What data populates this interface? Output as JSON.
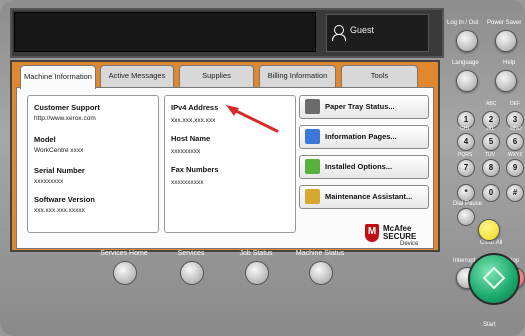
{
  "header": {
    "user": "Guest"
  },
  "tabs": [
    {
      "label": "Machine Information",
      "active": true
    },
    {
      "label": "Active Messages",
      "active": false
    },
    {
      "label": "Supplies",
      "active": false
    },
    {
      "label": "Billing Information",
      "active": false
    },
    {
      "label": "Tools",
      "active": false
    }
  ],
  "left_info": {
    "customer_support_label": "Customer Support",
    "customer_support_value": "http://www.xerox.com",
    "model_label": "Model",
    "model_value": "WorkCentre xxxx",
    "serial_label": "Serial Number",
    "serial_value": "xxxxxxxxx",
    "software_label": "Software Version",
    "software_value": "xxx.xxx.xxx.xxxxx"
  },
  "middle_info": {
    "ipv4_label": "IPv4 Address",
    "ipv4_value": "xxx.xxx.xxx.xxx",
    "host_label": "Host Name",
    "host_value": "xxxxxxxxx",
    "fax_label": "Fax Numbers",
    "fax_value": "xxxxxxxxxx"
  },
  "actions": [
    "Paper Tray Status...",
    "Information Pages...",
    "Installed Options...",
    "Maintenance Assistant..."
  ],
  "badge": {
    "brand": "McAfee",
    "line2": "SECURE",
    "device": "Device"
  },
  "hardware": {
    "login_out": "Log In / Out",
    "power_saver": "Power Saver",
    "language": "Language",
    "help": "Help",
    "interrupt": "Interrupt",
    "clear_all": "Clear All",
    "stop": "Stop",
    "start": "Start",
    "dial_pause": "Dial Pause",
    "bottom": [
      "Services Home",
      "Services",
      "Job Status",
      "Machine Status"
    ],
    "keypad_letters": [
      "",
      "ABC",
      "DEF",
      "GHI",
      "JKL",
      "MNO",
      "PQRS",
      "TUV",
      "WXYZ"
    ],
    "keypad": [
      "1",
      "2",
      "3",
      "4",
      "5",
      "6",
      "7",
      "8",
      "9",
      "*",
      "0",
      "#"
    ]
  },
  "colors": {
    "accent": "#e1872e",
    "panel": "#9a9a9a",
    "start": "#19a86a",
    "clear": "#f2d81c",
    "stop": "#e25a5a",
    "arrow": "#d62a2a"
  }
}
